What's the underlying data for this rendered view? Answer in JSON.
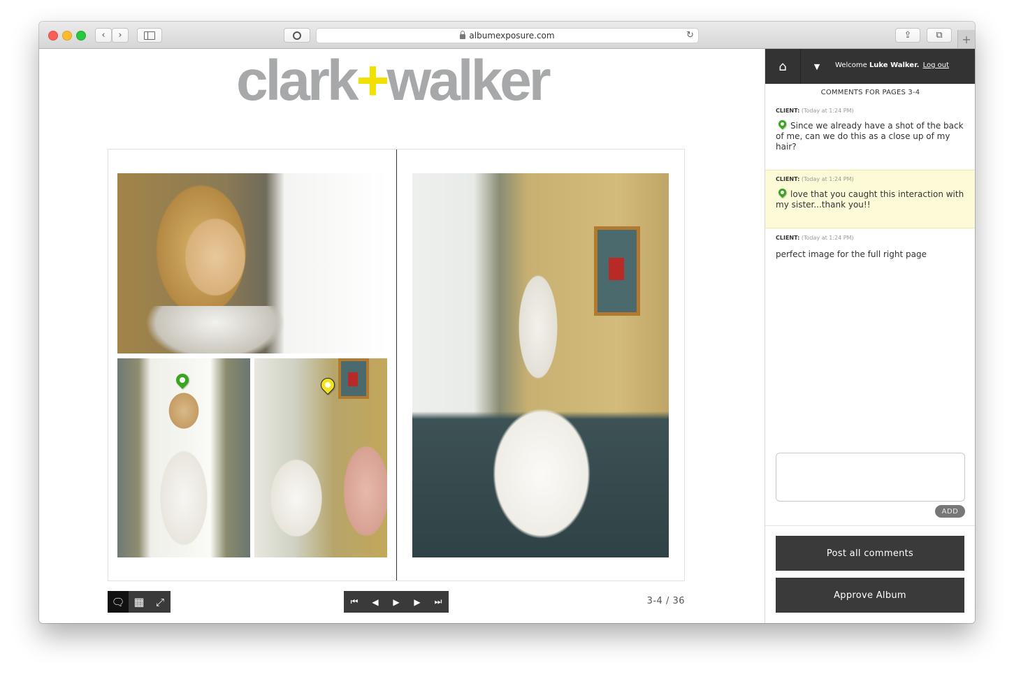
{
  "browser": {
    "url": "albumexposure.com"
  },
  "logo": {
    "left": "clark",
    "plus": "+",
    "right": "walker"
  },
  "album": {
    "page_count": "3-4 / 36"
  },
  "sidebar": {
    "welcome_prefix": "Welcome",
    "user_name": "Luke Walker.",
    "logout_label": "Log out",
    "heading": "COMMENTS FOR PAGES 3-4",
    "comments": [
      {
        "author": "CLIENT:",
        "time": "(Today at 1:24 PM)",
        "text": "Since we already have a shot of the back of me, can we do this as a close up of my hair?",
        "pin": "green",
        "highlighted": false
      },
      {
        "author": "CLIENT:",
        "time": "(Today at 1:24 PM)",
        "text": "love that you caught this interaction with my sister...thank you!!",
        "pin": "green",
        "highlighted": true
      },
      {
        "author": "CLIENT:",
        "time": "(Today at 1:24 PM)",
        "text": "perfect image for the full right page",
        "pin": null,
        "highlighted": false
      }
    ],
    "add_label": "ADD",
    "post_all_label": "Post all comments",
    "approve_label": "Approve Album"
  },
  "colors": {
    "pin_green": "#39a61f",
    "pin_yellow": "#f3e21c",
    "logo_gray": "#a7a8aa",
    "logo_plus": "#f2e100",
    "highlight": "#fdfad8",
    "dark_button": "#3a3a3a"
  }
}
